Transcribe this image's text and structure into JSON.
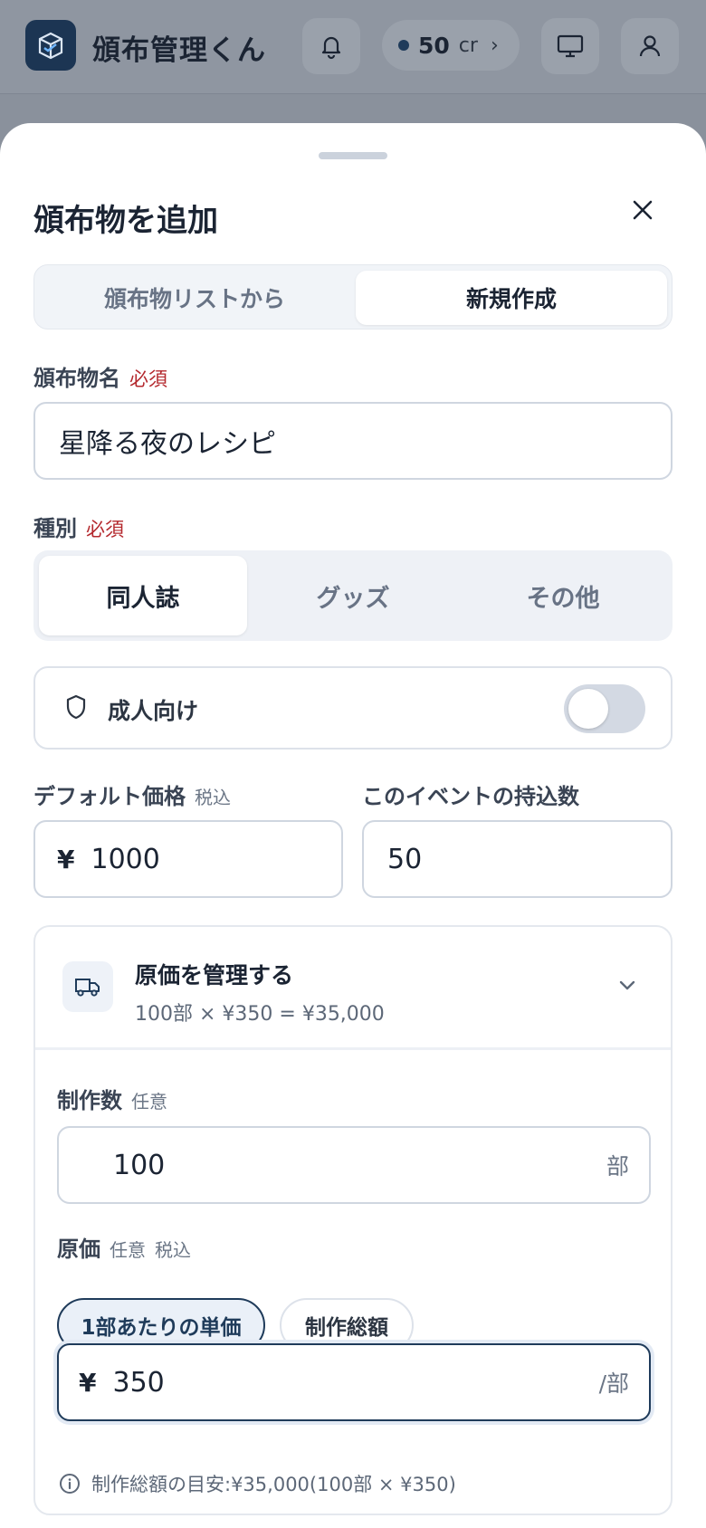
{
  "header": {
    "app_title": "頒布管理くん",
    "credits": "50",
    "credit_unit": "cr"
  },
  "sheet": {
    "title": "頒布物を追加",
    "tabs": [
      {
        "label": "頒布物リストから",
        "active": false
      },
      {
        "label": "新規作成",
        "active": true
      }
    ],
    "name_field": {
      "label": "頒布物名",
      "required": "必須",
      "value": "星降る夜のレシピ"
    },
    "type_field": {
      "label": "種別",
      "required": "必須",
      "options": [
        {
          "label": "同人誌",
          "selected": true
        },
        {
          "label": "グッズ",
          "selected": false
        },
        {
          "label": "その他",
          "selected": false
        }
      ]
    },
    "adult": {
      "label": "成人向け",
      "on": false
    },
    "price": {
      "label": "デフォルト価格",
      "sub": "税込",
      "currency": "¥",
      "value": "1000"
    },
    "bring_qty": {
      "label": "このイベントの持込数",
      "value": "50"
    },
    "cost": {
      "title": "原価を管理する",
      "summary": "100部 × ¥350 = ¥35,000",
      "production": {
        "label": "制作数",
        "sub": "任意",
        "value": "100",
        "unit": "部"
      },
      "cost_label": "原価",
      "cost_sub1": "任意",
      "cost_sub2": "税込",
      "mode_options": [
        {
          "label": "1部あたりの単価",
          "selected": true
        },
        {
          "label": "制作総額",
          "selected": false
        }
      ],
      "cost_currency": "¥",
      "cost_value": "350",
      "cost_unit": "/部",
      "hint": "制作総額の目安:¥35,000(100部 × ¥350)"
    }
  },
  "colors": {
    "accent": "#1f3b5a",
    "required": "#b4282d"
  }
}
